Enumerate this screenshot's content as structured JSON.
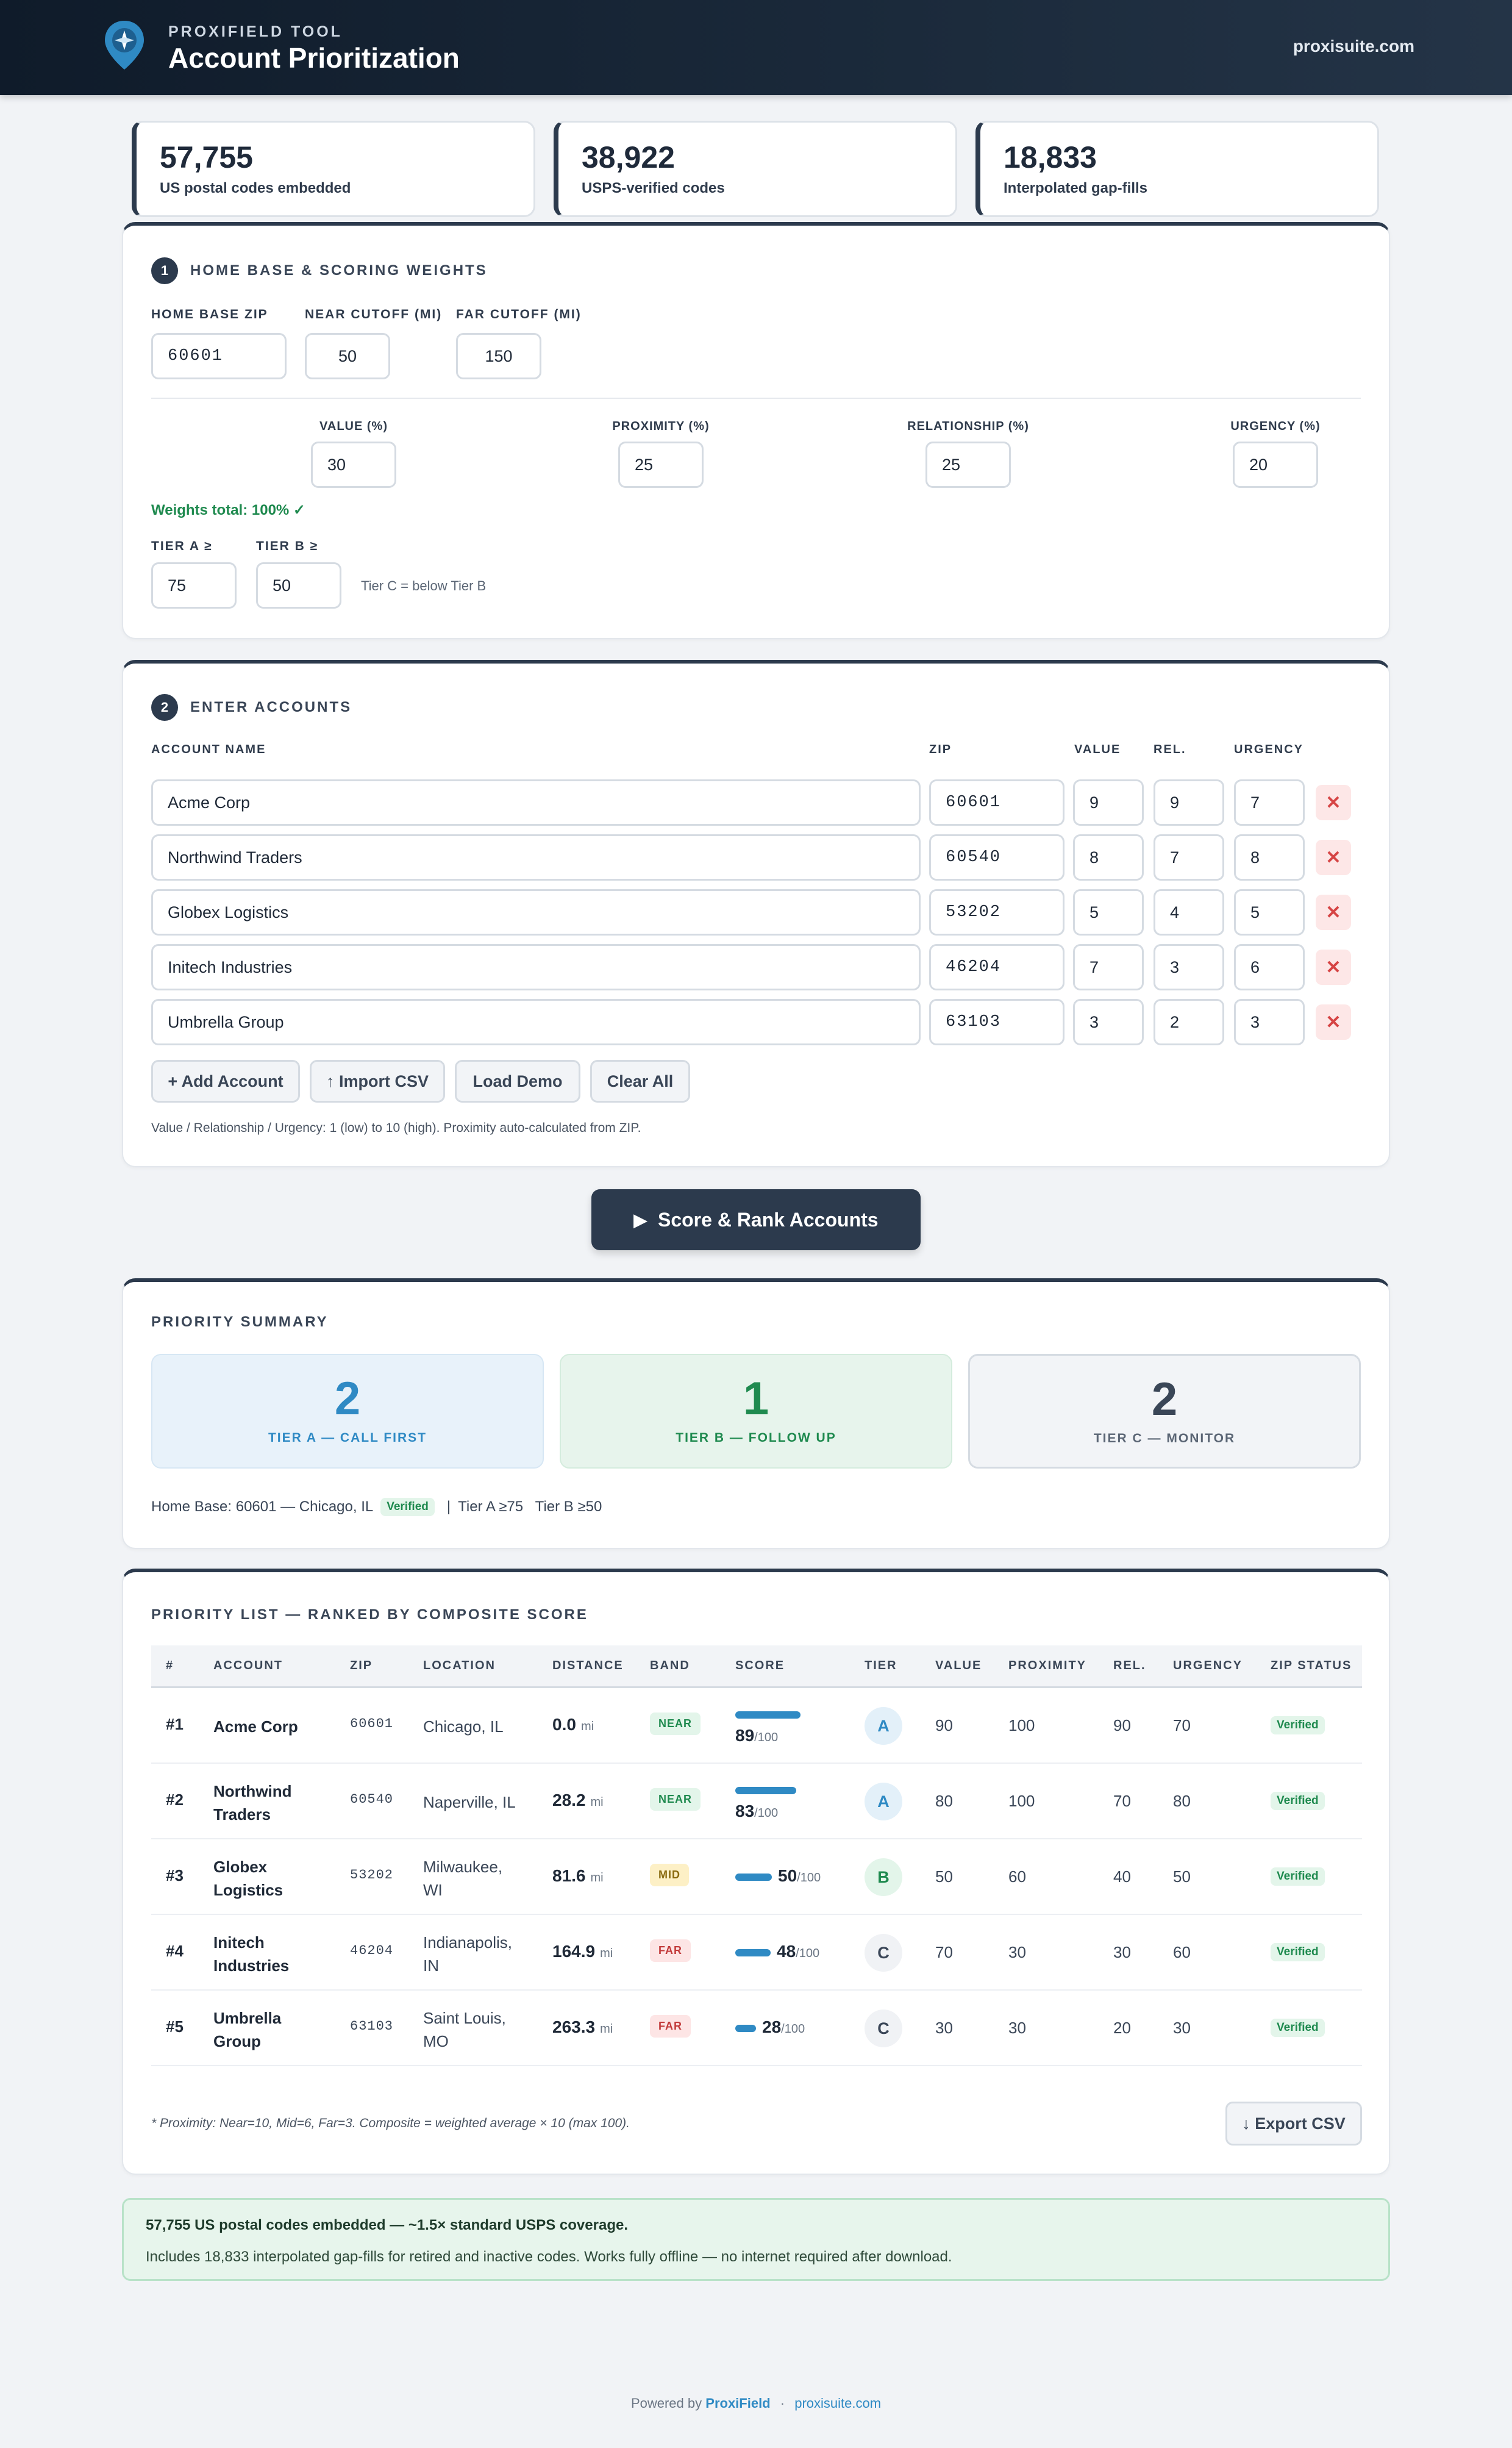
{
  "header": {
    "subtitle": "PROXIFIELD TOOL",
    "title": "Account Prioritization",
    "link": "proxisuite.com"
  },
  "stats": [
    {
      "value": "57,755",
      "label": "US postal codes embedded"
    },
    {
      "value": "38,922",
      "label": "USPS-verified codes"
    },
    {
      "value": "18,833",
      "label": "Interpolated gap-fills"
    }
  ],
  "settings": {
    "step": "1",
    "title": "HOME BASE & SCORING WEIGHTS",
    "home_zip_label": "HOME BASE ZIP",
    "home_zip": "60601",
    "near_label": "NEAR CUTOFF (MI)",
    "near": "50",
    "far_label": "FAR CUTOFF (MI)",
    "far": "150",
    "weights": [
      {
        "label": "VALUE (%)",
        "value": "30"
      },
      {
        "label": "PROXIMITY (%)",
        "value": "25"
      },
      {
        "label": "RELATIONSHIP (%)",
        "value": "25"
      },
      {
        "label": "URGENCY (%)",
        "value": "20"
      }
    ],
    "weights_total": "Weights total: 100% ✓",
    "tier_a_label": "TIER A ≥",
    "tier_a": "75",
    "tier_b_label": "TIER B ≥",
    "tier_b": "50",
    "tier_c_note": "Tier C = below Tier B"
  },
  "accounts": {
    "step": "2",
    "title": "ENTER ACCOUNTS",
    "col_name": "ACCOUNT NAME",
    "col_zip": "ZIP",
    "col_value": "VALUE",
    "col_rel": "REL.",
    "col_urgency": "URGENCY",
    "rows": [
      {
        "name": "Acme Corp",
        "zip": "60601",
        "value": "9",
        "rel": "9",
        "urgency": "7"
      },
      {
        "name": "Northwind Traders",
        "zip": "60540",
        "value": "8",
        "rel": "7",
        "urgency": "8"
      },
      {
        "name": "Globex Logistics",
        "zip": "53202",
        "value": "5",
        "rel": "4",
        "urgency": "5"
      },
      {
        "name": "Initech Industries",
        "zip": "46204",
        "value": "7",
        "rel": "3",
        "urgency": "6"
      },
      {
        "name": "Umbrella Group",
        "zip": "63103",
        "value": "3",
        "rel": "2",
        "urgency": "3"
      }
    ],
    "delete_glyph": "✕",
    "add_label": "+ Add Account",
    "import_label": "↑ Import CSV",
    "demo_label": "Load Demo",
    "clear_label": "Clear All",
    "hint": "Value / Relationship / Urgency: 1 (low) to 10 (high). Proximity auto-calculated from ZIP."
  },
  "cta": {
    "icon": "▶",
    "label": "Score & Rank Accounts"
  },
  "summary": {
    "title": "PRIORITY SUMMARY",
    "tiers": [
      {
        "count": "2",
        "label": "TIER A — CALL FIRST",
        "color": "#2f8ac4"
      },
      {
        "count": "1",
        "label": "TIER B — FOLLOW UP",
        "color": "#1f8a4f"
      },
      {
        "count": "2",
        "label": "TIER C — MONITOR",
        "color": "#3a4657"
      }
    ],
    "home_base": "Home Base: 60601 — Chicago, IL",
    "home_verified": "Verified",
    "separator": "|",
    "thresholds": "Tier A ≥75   Tier B ≥50"
  },
  "ranking": {
    "title": "PRIORITY LIST — RANKED BY COMPOSITE SCORE",
    "columns": [
      "#",
      "ACCOUNT",
      "ZIP",
      "LOCATION",
      "DISTANCE",
      "BAND",
      "SCORE",
      "TIER",
      "VALUE",
      "PROXIMITY",
      "REL.",
      "URGENCY",
      "ZIP STATUS"
    ],
    "dist_unit": "mi",
    "score_max": "/100",
    "rows": [
      {
        "rank": "#1",
        "account": [
          "Acme Corp"
        ],
        "zip": "60601",
        "location": [
          "Chicago, IL"
        ],
        "distance": "0.0",
        "band": "NEAR",
        "score": "89",
        "score_frac": 0.89,
        "tier": "A",
        "value": "90",
        "proximity": "100",
        "rel": "90",
        "urgency": "70",
        "status": "Verified"
      },
      {
        "rank": "#2",
        "account": [
          "Northwind",
          "Traders"
        ],
        "zip": "60540",
        "location": [
          "Naperville, IL"
        ],
        "distance": "28.2",
        "band": "NEAR",
        "score": "83",
        "score_frac": 0.83,
        "tier": "A",
        "value": "80",
        "proximity": "100",
        "rel": "70",
        "urgency": "80",
        "status": "Verified"
      },
      {
        "rank": "#3",
        "account": [
          "Globex",
          "Logistics"
        ],
        "zip": "53202",
        "location": [
          "Milwaukee,",
          "WI"
        ],
        "distance": "81.6",
        "band": "MID",
        "score": "50",
        "score_frac": 0.5,
        "tier": "B",
        "value": "50",
        "proximity": "60",
        "rel": "40",
        "urgency": "50",
        "status": "Verified"
      },
      {
        "rank": "#4",
        "account": [
          "Initech",
          "Industries"
        ],
        "zip": "46204",
        "location": [
          "Indianapolis,",
          "IN"
        ],
        "distance": "164.9",
        "band": "FAR",
        "score": "48",
        "score_frac": 0.48,
        "tier": "C",
        "value": "70",
        "proximity": "30",
        "rel": "30",
        "urgency": "60",
        "status": "Verified"
      },
      {
        "rank": "#5",
        "account": [
          "Umbrella",
          "Group"
        ],
        "zip": "63103",
        "location": [
          "Saint Louis,",
          "MO"
        ],
        "distance": "263.3",
        "band": "FAR",
        "score": "28",
        "score_frac": 0.28,
        "tier": "C",
        "value": "30",
        "proximity": "30",
        "rel": "20",
        "urgency": "30",
        "status": "Verified"
      }
    ],
    "footnote": "* Proximity: Near=10, Mid=6, Far=3. Composite = weighted average × 10 (max 100).",
    "export_label": "↓ Export CSV"
  },
  "coverage": {
    "headline": "57,755 US postal codes embedded — ~1.5× standard USPS coverage.",
    "detail": "Includes 18,833 interpolated gap-fills for retired and inactive codes. Works fully offline — no internet required after download."
  },
  "footer": {
    "powered": "Powered by",
    "brand": "ProxiField",
    "dot": "·",
    "site": "proxisuite.com"
  },
  "colors": {
    "accent": "#2f8ac4",
    "navy": "#2c3a4d",
    "green": "#1f8a4f",
    "danger": "#d64545"
  }
}
